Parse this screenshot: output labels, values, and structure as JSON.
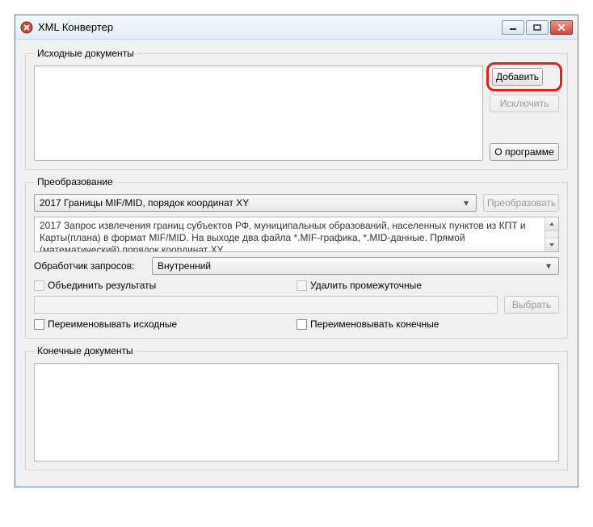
{
  "window": {
    "title": "XML Конвертер"
  },
  "source": {
    "legend": "Исходные документы",
    "add_label": "Добавить",
    "remove_label": "Исключить",
    "about_label": "О программе"
  },
  "conversion": {
    "legend": "Преобразование",
    "selected": "2017 Границы MIF/MID, порядок координат XY",
    "convert_label": "Преобразовать",
    "description": "2017 Запрос извлечения границ субъектов РФ, муниципальных образований, населенных пунктов из КПТ и Карты(плана) в формат MIF/MID. На выходе два файла *.MIF-графика, *.MID-данные. Прямой (математический) порядок координат XY",
    "handler_label": "Обработчик запросов:",
    "handler_value": "Внутренний",
    "merge_label": "Объединить результаты",
    "delete_label": "Удалить промежуточные",
    "choose_label": "Выбрать",
    "rename_src_label": "Переименовывать исходные",
    "rename_dst_label": "Переименовывать конечные"
  },
  "output": {
    "legend": "Конечные документы"
  }
}
